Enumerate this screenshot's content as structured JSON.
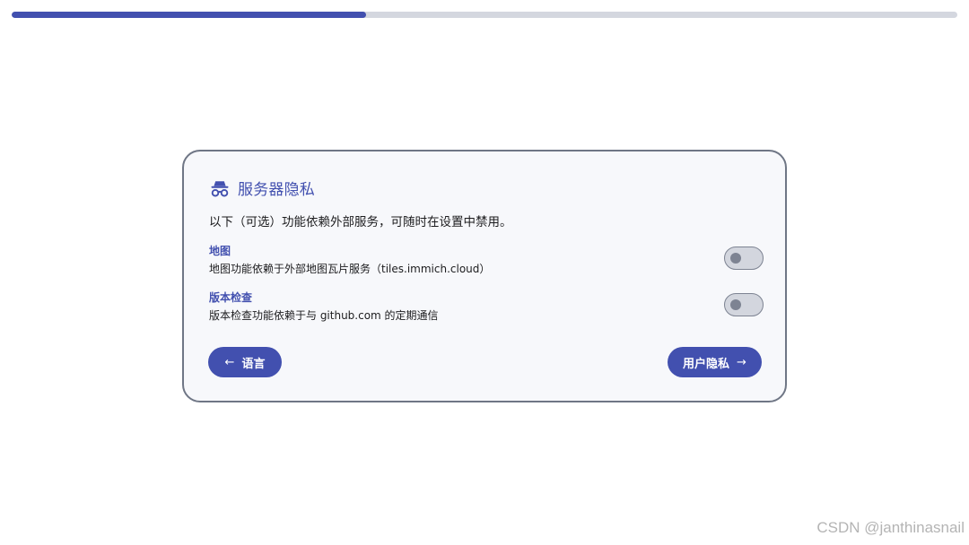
{
  "progress": {
    "fraction": 0.375
  },
  "card": {
    "title": "服务器隐私",
    "title_icon": "incognito-icon",
    "intro": "以下（可选）功能依赖外部服务，可随时在设置中禁用。",
    "settings": [
      {
        "label": "地图",
        "description": "地图功能依赖于外部地图瓦片服务（tiles.immich.cloud）",
        "enabled": false
      },
      {
        "label": "版本检查",
        "description": "版本检查功能依赖于与 github.com 的定期通信",
        "enabled": false
      }
    ],
    "back_button": {
      "label": "语言",
      "icon": "arrow-left-icon",
      "glyph": "←"
    },
    "next_button": {
      "label": "用户隐私",
      "icon": "arrow-right-icon",
      "glyph": "→"
    }
  },
  "watermark": "CSDN @janthinasnail",
  "colors": {
    "accent": "#4250af",
    "track": "#d4d7df",
    "card_bg": "#f7f8fb",
    "border": "#6f7685"
  }
}
